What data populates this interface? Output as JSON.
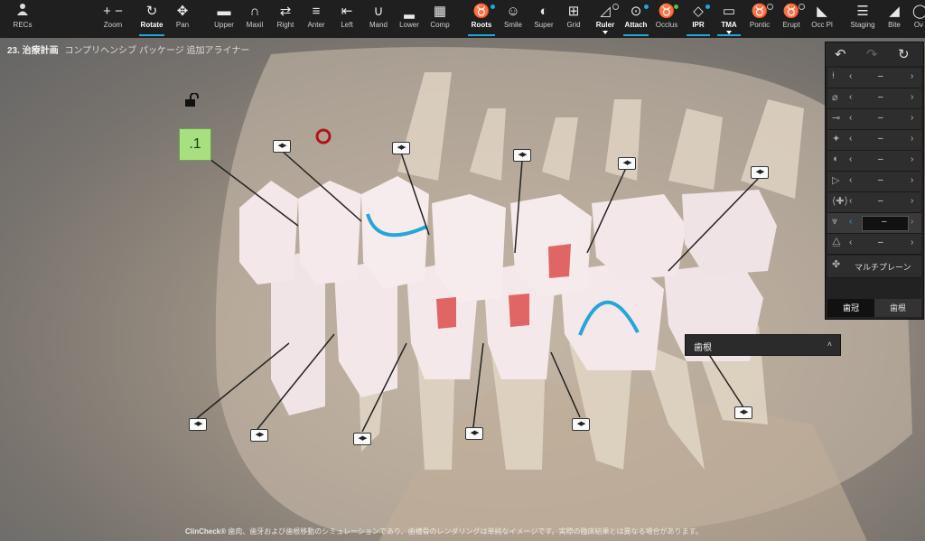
{
  "toolbar": {
    "recs": "RECs",
    "items": [
      {
        "icon": "+ −",
        "label": "Zoom"
      },
      {
        "icon": "↻",
        "label": "Rotate"
      },
      {
        "icon": "✥",
        "label": "Pan"
      },
      {
        "icon": "▬",
        "label": "Upper"
      },
      {
        "icon": "∩",
        "label": "Maxil"
      },
      {
        "icon": "⇄",
        "label": "Right"
      },
      {
        "icon": "≡",
        "label": "Anter"
      },
      {
        "icon": "⇤",
        "label": "Left"
      },
      {
        "icon": "∪",
        "label": "Mand"
      },
      {
        "icon": "▂",
        "label": "Lower"
      },
      {
        "icon": "▦",
        "label": "Comp"
      },
      {
        "icon": "♉",
        "label": "Roots"
      },
      {
        "icon": "☺",
        "label": "Smile"
      },
      {
        "icon": "◐",
        "label": "Super"
      },
      {
        "icon": "⊞",
        "label": "Grid"
      },
      {
        "icon": "◿",
        "label": "Ruler"
      },
      {
        "icon": "⊙",
        "label": "Attach"
      },
      {
        "icon": "♉",
        "label": "Occlus"
      },
      {
        "icon": "◇",
        "label": "IPR"
      },
      {
        "icon": "▭",
        "label": "TMA"
      },
      {
        "icon": "♉",
        "label": "Pontic"
      },
      {
        "icon": "♉",
        "label": "Erupt"
      },
      {
        "icon": "◣",
        "label": "Occ Pl"
      },
      {
        "icon": "☰",
        "label": "Staging"
      },
      {
        "icon": "◢",
        "label": "Bite"
      },
      {
        "icon": "◯",
        "label": "Ov"
      }
    ]
  },
  "plan": {
    "title": "23. 治療計画",
    "subtitle": "コンプリヘンシブ パッケージ 追加アライナー"
  },
  "stage_badge": ".1",
  "handle_glyph": "◀▶",
  "panel": {
    "undo": "↶",
    "redo": "↷",
    "reset": "↻",
    "rows": [
      {
        "value": "–"
      },
      {
        "value": "–"
      },
      {
        "value": "–"
      },
      {
        "value": "–"
      },
      {
        "value": "–"
      },
      {
        "value": "–"
      },
      {
        "value": "–"
      },
      {
        "value": "–"
      },
      {
        "value": "–"
      }
    ],
    "multiplane": "マルチプレーン",
    "crown_button": "歯冠",
    "root_button": "歯根"
  },
  "dropdown": {
    "label": "歯根",
    "chevron": "˄"
  },
  "footer": {
    "brand": "ClinCheck®",
    "text": " 歯肉、歯牙および歯根移動のシミュレーションであり、歯槽骨のレンダリングは単純なイメージです。実際の臨床結果とは異なる場合があります。"
  },
  "colors": {
    "accent": "#23a6d8",
    "badge": "#a7e07e",
    "attachment": "#e06565"
  }
}
